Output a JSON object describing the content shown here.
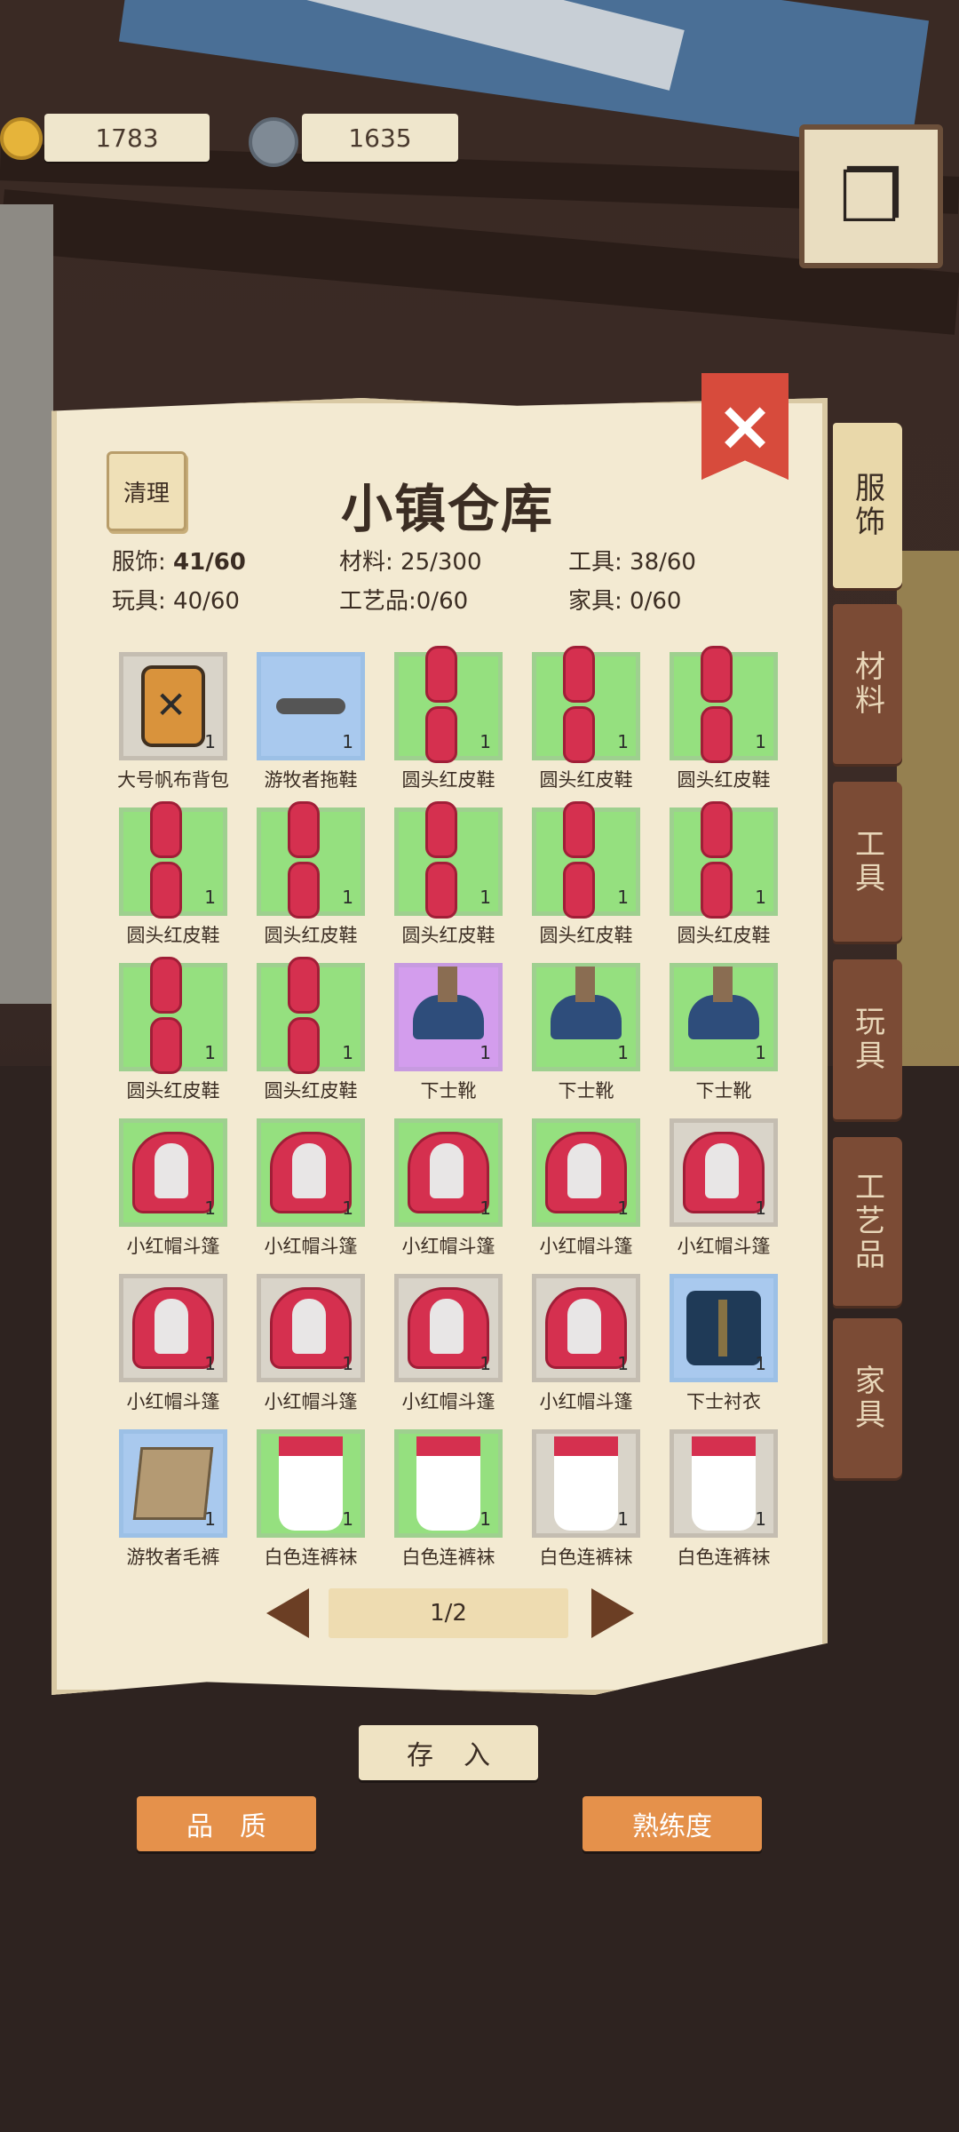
{
  "hud": {
    "coins": "1783",
    "gear": "1635"
  },
  "warehouse": {
    "title": "小镇仓库",
    "clean_label": "清理",
    "stats": [
      {
        "label": "服饰: ",
        "value": "41/60",
        "bold": true
      },
      {
        "label": "材料: ",
        "value": "25/300"
      },
      {
        "label": "工具: ",
        "value": "38/60"
      },
      {
        "label": "玩具: ",
        "value": "40/60"
      },
      {
        "label": "工艺品:",
        "value": "0/60"
      },
      {
        "label": "家具: ",
        "value": "0/60"
      }
    ],
    "tabs": [
      "服饰",
      "材料",
      "工具",
      "玩具",
      "工艺品",
      "家具"
    ],
    "active_tab": "服饰",
    "items": [
      {
        "name": "大号帆布背包",
        "count": "1",
        "rarity": "gray",
        "icon": "backpack"
      },
      {
        "name": "游牧者拖鞋",
        "count": "1",
        "rarity": "blue",
        "icon": "slipper"
      },
      {
        "name": "圆头红皮鞋",
        "count": "1",
        "rarity": "green",
        "icon": "shoes"
      },
      {
        "name": "圆头红皮鞋",
        "count": "1",
        "rarity": "green",
        "icon": "shoes"
      },
      {
        "name": "圆头红皮鞋",
        "count": "1",
        "rarity": "green",
        "icon": "shoes"
      },
      {
        "name": "圆头红皮鞋",
        "count": "1",
        "rarity": "green",
        "icon": "shoes"
      },
      {
        "name": "圆头红皮鞋",
        "count": "1",
        "rarity": "green",
        "icon": "shoes"
      },
      {
        "name": "圆头红皮鞋",
        "count": "1",
        "rarity": "green",
        "icon": "shoes"
      },
      {
        "name": "圆头红皮鞋",
        "count": "1",
        "rarity": "green",
        "icon": "shoes"
      },
      {
        "name": "圆头红皮鞋",
        "count": "1",
        "rarity": "green",
        "icon": "shoes"
      },
      {
        "name": "圆头红皮鞋",
        "count": "1",
        "rarity": "green",
        "icon": "shoes"
      },
      {
        "name": "圆头红皮鞋",
        "count": "1",
        "rarity": "green",
        "icon": "shoes"
      },
      {
        "name": "下士靴",
        "count": "1",
        "rarity": "purple",
        "icon": "boots"
      },
      {
        "name": "下士靴",
        "count": "1",
        "rarity": "green",
        "icon": "boots"
      },
      {
        "name": "下士靴",
        "count": "1",
        "rarity": "green",
        "icon": "boots"
      },
      {
        "name": "小红帽斗篷",
        "count": "1",
        "rarity": "green",
        "icon": "cloak"
      },
      {
        "name": "小红帽斗篷",
        "count": "1",
        "rarity": "green",
        "icon": "cloak"
      },
      {
        "name": "小红帽斗篷",
        "count": "1",
        "rarity": "green",
        "icon": "cloak"
      },
      {
        "name": "小红帽斗篷",
        "count": "1",
        "rarity": "green",
        "icon": "cloak"
      },
      {
        "name": "小红帽斗篷",
        "count": "1",
        "rarity": "gray",
        "icon": "cloak"
      },
      {
        "name": "小红帽斗篷",
        "count": "1",
        "rarity": "gray",
        "icon": "cloak"
      },
      {
        "name": "小红帽斗篷",
        "count": "1",
        "rarity": "gray",
        "icon": "cloak"
      },
      {
        "name": "小红帽斗篷",
        "count": "1",
        "rarity": "gray",
        "icon": "cloak"
      },
      {
        "name": "小红帽斗篷",
        "count": "1",
        "rarity": "gray",
        "icon": "cloak"
      },
      {
        "name": "下士衬衣",
        "count": "1",
        "rarity": "blue",
        "icon": "shirt"
      },
      {
        "name": "游牧者毛裤",
        "count": "1",
        "rarity": "blue",
        "icon": "pants"
      },
      {
        "name": "白色连裤袜",
        "count": "1",
        "rarity": "green",
        "icon": "tights"
      },
      {
        "name": "白色连裤袜",
        "count": "1",
        "rarity": "green",
        "icon": "tights"
      },
      {
        "name": "白色连裤袜",
        "count": "1",
        "rarity": "gray",
        "icon": "tights"
      },
      {
        "name": "白色连裤袜",
        "count": "1",
        "rarity": "gray",
        "icon": "tights"
      }
    ],
    "page": "1/2"
  },
  "buttons": {
    "deposit": "存入",
    "quality": "品质",
    "proficiency": "熟练度"
  },
  "colors": {
    "close": "#d74b3c",
    "tab_active": "#e9d8aa",
    "tab_inactive": "#7b4b35",
    "rarity_green": "#95e07f",
    "rarity_blue": "#a9c9ee",
    "rarity_purple": "#d39ded",
    "rarity_gray": "#d9d4c9"
  }
}
